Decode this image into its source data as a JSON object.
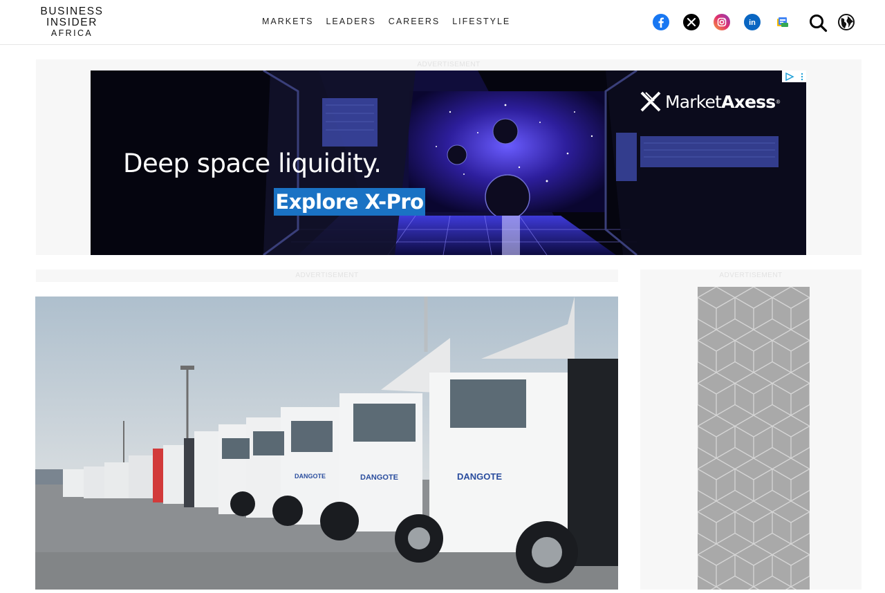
{
  "site": {
    "logo_line1": "BUSINESS",
    "logo_line2": "INSIDER",
    "logo_line3": "AFRICA"
  },
  "nav": {
    "items": [
      {
        "label": "MARKETS"
      },
      {
        "label": "LEADERS"
      },
      {
        "label": "CAREERS"
      },
      {
        "label": "LIFESTYLE"
      }
    ]
  },
  "socials": [
    {
      "icon": "facebook-icon",
      "color": "#1877f2"
    },
    {
      "icon": "x-icon",
      "color": "#000000"
    },
    {
      "icon": "instagram-icon",
      "color": "#e1306c"
    },
    {
      "icon": "linkedin-icon",
      "color": "#0a66c2"
    },
    {
      "icon": "google-news-icon",
      "color": "#4285f4"
    }
  ],
  "header_icons": {
    "search": "search-icon",
    "globe": "globe-icon"
  },
  "ads": {
    "label": "ADVERTISEMENT",
    "banner": {
      "headline": "Deep space liquidity.",
      "cta": "Explore X-Pro",
      "brand_light": "Market",
      "brand_bold": "Axess",
      "brand_mark": "®",
      "cta_color": "#1a72c4"
    }
  }
}
